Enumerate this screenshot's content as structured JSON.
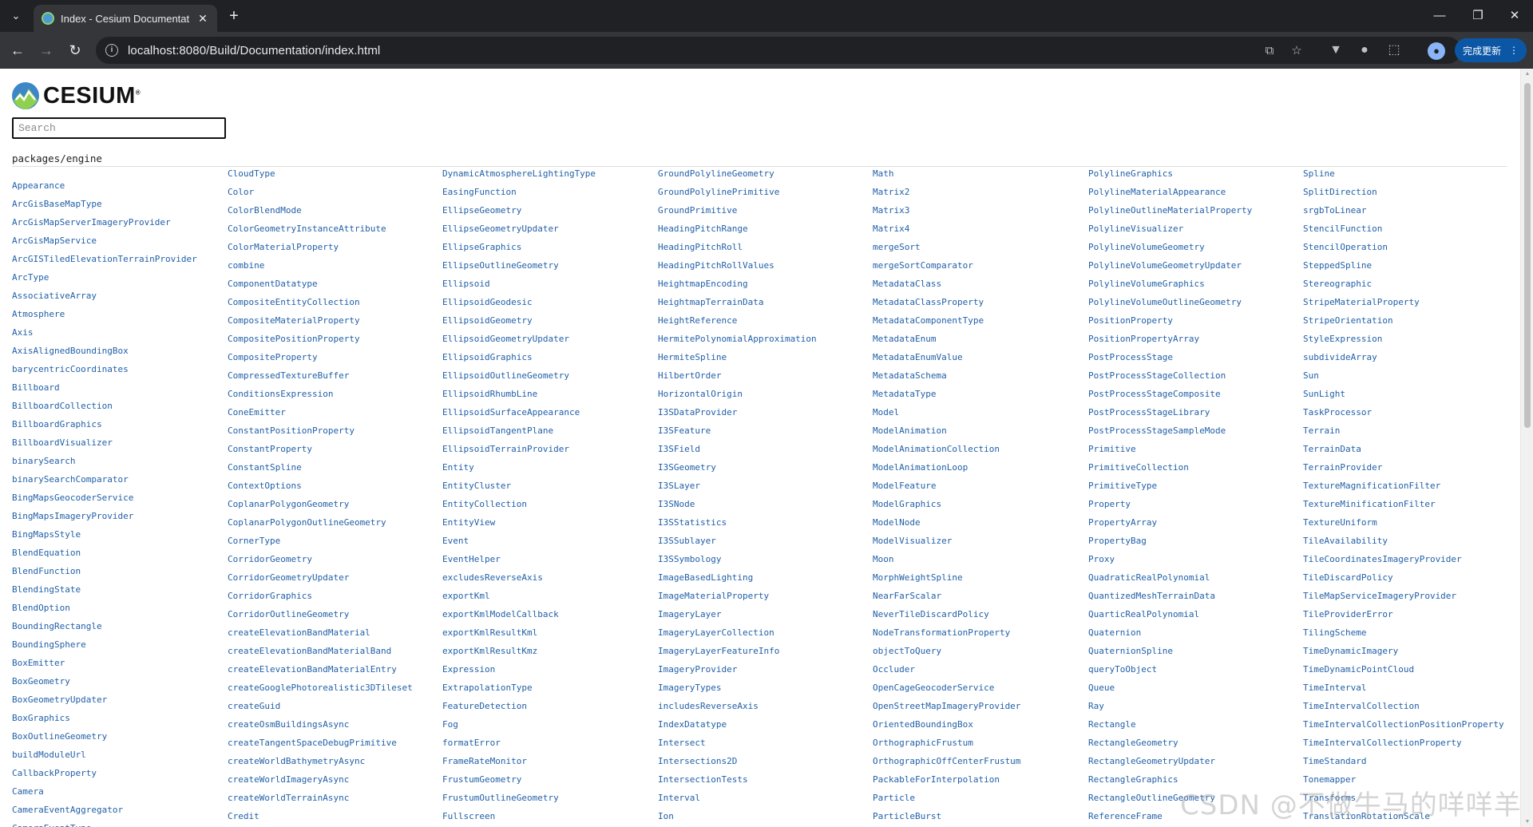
{
  "browser": {
    "tab_title": "Index - Cesium Documentati",
    "tab_close": "✕",
    "new_tab": "+",
    "url": "localhost:8080/Build/Documentation/index.html",
    "update_label": "完成更新",
    "accent_color": "#0b57a6"
  },
  "page": {
    "logo_text": "CESIUM",
    "logo_reg": "®",
    "search_placeholder": "Search",
    "section_title": "packages/engine",
    "link_color": "#2260a8",
    "watermark": "CSDN @不做牛马的咩咩羊"
  },
  "columns": [
    [
      "Appearance",
      "ArcGisBaseMapType",
      "ArcGisMapServerImageryProvider",
      "ArcGisMapService",
      "ArcGISTiledElevationTerrainProvider",
      "ArcType",
      "AssociativeArray",
      "Atmosphere",
      "Axis",
      "AxisAlignedBoundingBox",
      "barycentricCoordinates",
      "Billboard",
      "BillboardCollection",
      "BillboardGraphics",
      "BillboardVisualizer",
      "binarySearch",
      "binarySearchComparator",
      "BingMapsGeocoderService",
      "BingMapsImageryProvider",
      "BingMapsStyle",
      "BlendEquation",
      "BlendFunction",
      "BlendingState",
      "BlendOption",
      "BoundingRectangle",
      "BoundingSphere",
      "BoxEmitter",
      "BoxGeometry",
      "BoxGeometryUpdater",
      "BoxGraphics",
      "BoxOutlineGeometry",
      "buildModuleUrl",
      "CallbackProperty",
      "Camera",
      "CameraEventAggregator",
      "CameraEventType"
    ],
    [
      "CloudType",
      "Color",
      "ColorBlendMode",
      "ColorGeometryInstanceAttribute",
      "ColorMaterialProperty",
      "combine",
      "ComponentDatatype",
      "CompositeEntityCollection",
      "CompositeMaterialProperty",
      "CompositePositionProperty",
      "CompositeProperty",
      "CompressedTextureBuffer",
      "ConditionsExpression",
      "ConeEmitter",
      "ConstantPositionProperty",
      "ConstantProperty",
      "ConstantSpline",
      "ContextOptions",
      "CoplanarPolygonGeometry",
      "CoplanarPolygonOutlineGeometry",
      "CornerType",
      "CorridorGeometry",
      "CorridorGeometryUpdater",
      "CorridorGraphics",
      "CorridorOutlineGeometry",
      "createElevationBandMaterial",
      "createElevationBandMaterialBand",
      "createElevationBandMaterialEntry",
      "createGooglePhotorealistic3DTileset",
      "createGuid",
      "createOsmBuildingsAsync",
      "createTangentSpaceDebugPrimitive",
      "createWorldBathymetryAsync",
      "createWorldImageryAsync",
      "createWorldTerrainAsync",
      "Credit"
    ],
    [
      "DynamicAtmosphereLightingType",
      "EasingFunction",
      "EllipseGeometry",
      "EllipseGeometryUpdater",
      "EllipseGraphics",
      "EllipseOutlineGeometry",
      "Ellipsoid",
      "EllipsoidGeodesic",
      "EllipsoidGeometry",
      "EllipsoidGeometryUpdater",
      "EllipsoidGraphics",
      "EllipsoidOutlineGeometry",
      "EllipsoidRhumbLine",
      "EllipsoidSurfaceAppearance",
      "EllipsoidTangentPlane",
      "EllipsoidTerrainProvider",
      "Entity",
      "EntityCluster",
      "EntityCollection",
      "EntityView",
      "Event",
      "EventHelper",
      "excludesReverseAxis",
      "exportKml",
      "exportKmlModelCallback",
      "exportKmlResultKml",
      "exportKmlResultKmz",
      "Expression",
      "ExtrapolationType",
      "FeatureDetection",
      "Fog",
      "formatError",
      "FrameRateMonitor",
      "FrustumGeometry",
      "FrustumOutlineGeometry",
      "Fullscreen"
    ],
    [
      "GroundPolylineGeometry",
      "GroundPolylinePrimitive",
      "GroundPrimitive",
      "HeadingPitchRange",
      "HeadingPitchRoll",
      "HeadingPitchRollValues",
      "HeightmapEncoding",
      "HeightmapTerrainData",
      "HeightReference",
      "HermitePolynomialApproximation",
      "HermiteSpline",
      "HilbertOrder",
      "HorizontalOrigin",
      "I3SDataProvider",
      "I3SFeature",
      "I3SField",
      "I3SGeometry",
      "I3SLayer",
      "I3SNode",
      "I3SStatistics",
      "I3SSublayer",
      "I3SSymbology",
      "ImageBasedLighting",
      "ImageMaterialProperty",
      "ImageryLayer",
      "ImageryLayerCollection",
      "ImageryLayerFeatureInfo",
      "ImageryProvider",
      "ImageryTypes",
      "includesReverseAxis",
      "IndexDatatype",
      "Intersect",
      "Intersections2D",
      "IntersectionTests",
      "Interval",
      "Ion"
    ],
    [
      "Math",
      "Matrix2",
      "Matrix3",
      "Matrix4",
      "mergeSort",
      "mergeSortComparator",
      "MetadataClass",
      "MetadataClassProperty",
      "MetadataComponentType",
      "MetadataEnum",
      "MetadataEnumValue",
      "MetadataSchema",
      "MetadataType",
      "Model",
      "ModelAnimation",
      "ModelAnimationCollection",
      "ModelAnimationLoop",
      "ModelFeature",
      "ModelGraphics",
      "ModelNode",
      "ModelVisualizer",
      "Moon",
      "MorphWeightSpline",
      "NearFarScalar",
      "NeverTileDiscardPolicy",
      "NodeTransformationProperty",
      "objectToQuery",
      "Occluder",
      "OpenCageGeocoderService",
      "OpenStreetMapImageryProvider",
      "OrientedBoundingBox",
      "OrthographicFrustum",
      "OrthographicOffCenterFrustum",
      "PackableForInterpolation",
      "Particle",
      "ParticleBurst"
    ],
    [
      "PolylineGraphics",
      "PolylineMaterialAppearance",
      "PolylineOutlineMaterialProperty",
      "PolylineVisualizer",
      "PolylineVolumeGeometry",
      "PolylineVolumeGeometryUpdater",
      "PolylineVolumeGraphics",
      "PolylineVolumeOutlineGeometry",
      "PositionProperty",
      "PositionPropertyArray",
      "PostProcessStage",
      "PostProcessStageCollection",
      "PostProcessStageComposite",
      "PostProcessStageLibrary",
      "PostProcessStageSampleMode",
      "Primitive",
      "PrimitiveCollection",
      "PrimitiveType",
      "Property",
      "PropertyArray",
      "PropertyBag",
      "Proxy",
      "QuadraticRealPolynomial",
      "QuantizedMeshTerrainData",
      "QuarticRealPolynomial",
      "Quaternion",
      "QuaternionSpline",
      "queryToObject",
      "Queue",
      "Ray",
      "Rectangle",
      "RectangleGeometry",
      "RectangleGeometryUpdater",
      "RectangleGraphics",
      "RectangleOutlineGeometry",
      "ReferenceFrame"
    ],
    [
      "Spline",
      "SplitDirection",
      "srgbToLinear",
      "StencilFunction",
      "StencilOperation",
      "SteppedSpline",
      "Stereographic",
      "StripeMaterialProperty",
      "StripeOrientation",
      "StyleExpression",
      "subdivideArray",
      "Sun",
      "SunLight",
      "TaskProcessor",
      "Terrain",
      "TerrainData",
      "TerrainProvider",
      "TextureMagnificationFilter",
      "TextureMinificationFilter",
      "TextureUniform",
      "TileAvailability",
      "TileCoordinatesImageryProvider",
      "TileDiscardPolicy",
      "TileMapServiceImageryProvider",
      "TileProviderError",
      "TilingScheme",
      "TimeDynamicImagery",
      "TimeDynamicPointCloud",
      "TimeInterval",
      "TimeIntervalCollection",
      "TimeIntervalCollectionPositionProperty",
      "TimeIntervalCollectionProperty",
      "TimeStandard",
      "Tonemapper",
      "Transforms",
      "TranslationRotationScale"
    ]
  ]
}
